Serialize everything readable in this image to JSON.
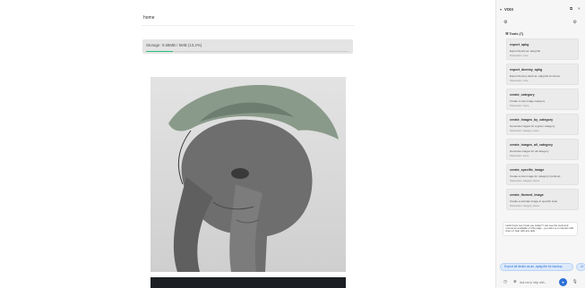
{
  "main": {
    "home_link": "home",
    "storage": {
      "text": "Storage: 0.68MB / 5MB (13.2%)",
      "percent": 13.2
    }
  },
  "panel": {
    "title": "VOIX",
    "tools_header": "Tools (7)",
    "tools": [
      {
        "name": "export_apkg",
        "desc": "Export decks as .apkg file",
        "params": "Parameters: none"
      },
      {
        "name": "export_dummy_apkg",
        "desc": "Export dummy deck as .apkg file for demo",
        "params": "Parameters: none"
      },
      {
        "name": "create_category",
        "desc": "Create a new image category",
        "params": "Parameters: name"
      },
      {
        "name": "create_images_by_category",
        "desc": "Generate images for a given category",
        "params": "Parameters: category, count"
      },
      {
        "name": "create_images_all_category",
        "desc": "Generate images for all category",
        "params": "Parameters: count"
      },
      {
        "name": "create_specific_image",
        "desc": "Create a new image for category (retrieve)",
        "params": "Parameters: category, theme"
      },
      {
        "name": "create_themed_image",
        "desc": "Create a animate image in specific style",
        "params": "Parameters: category, theme"
      }
    ],
    "message": "Hello! How can I help you today? I can see the tools and resources available on this page - you ask me to interact with them or help with any task.",
    "suggestion_1": "Export all decks as an .apkg file for backup",
    "suggestion_2": "Cr",
    "input_placeholder": "Ask me to help with..."
  }
}
